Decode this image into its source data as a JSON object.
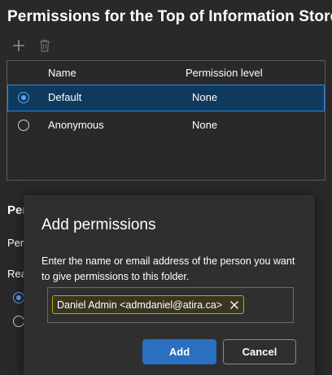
{
  "page": {
    "title": "Permissions for the Top of Information Store..."
  },
  "toolbar": {
    "add_icon": "plus-icon",
    "delete_icon": "trash-icon"
  },
  "table": {
    "columns": [
      "Name",
      "Permission level"
    ],
    "rows": [
      {
        "name": "Default",
        "level": "None",
        "selected": true
      },
      {
        "name": "Anonymous",
        "level": "None",
        "selected": false
      }
    ]
  },
  "background": {
    "section_heading": "Per",
    "label_1": "Per",
    "label_2": "Rea"
  },
  "dialog": {
    "title": "Add permissions",
    "description": "Enter the name or email address of the person you want to give permissions to this folder.",
    "chip_text": "Daniel Admin <admdaniel@atira.ca>",
    "chip_remove_icon": "close-icon",
    "add_label": "Add",
    "cancel_label": "Cancel"
  },
  "colors": {
    "accent": "#2a6fc0",
    "chip_border": "#c8a400",
    "selected_row": "#0f3a5e"
  }
}
